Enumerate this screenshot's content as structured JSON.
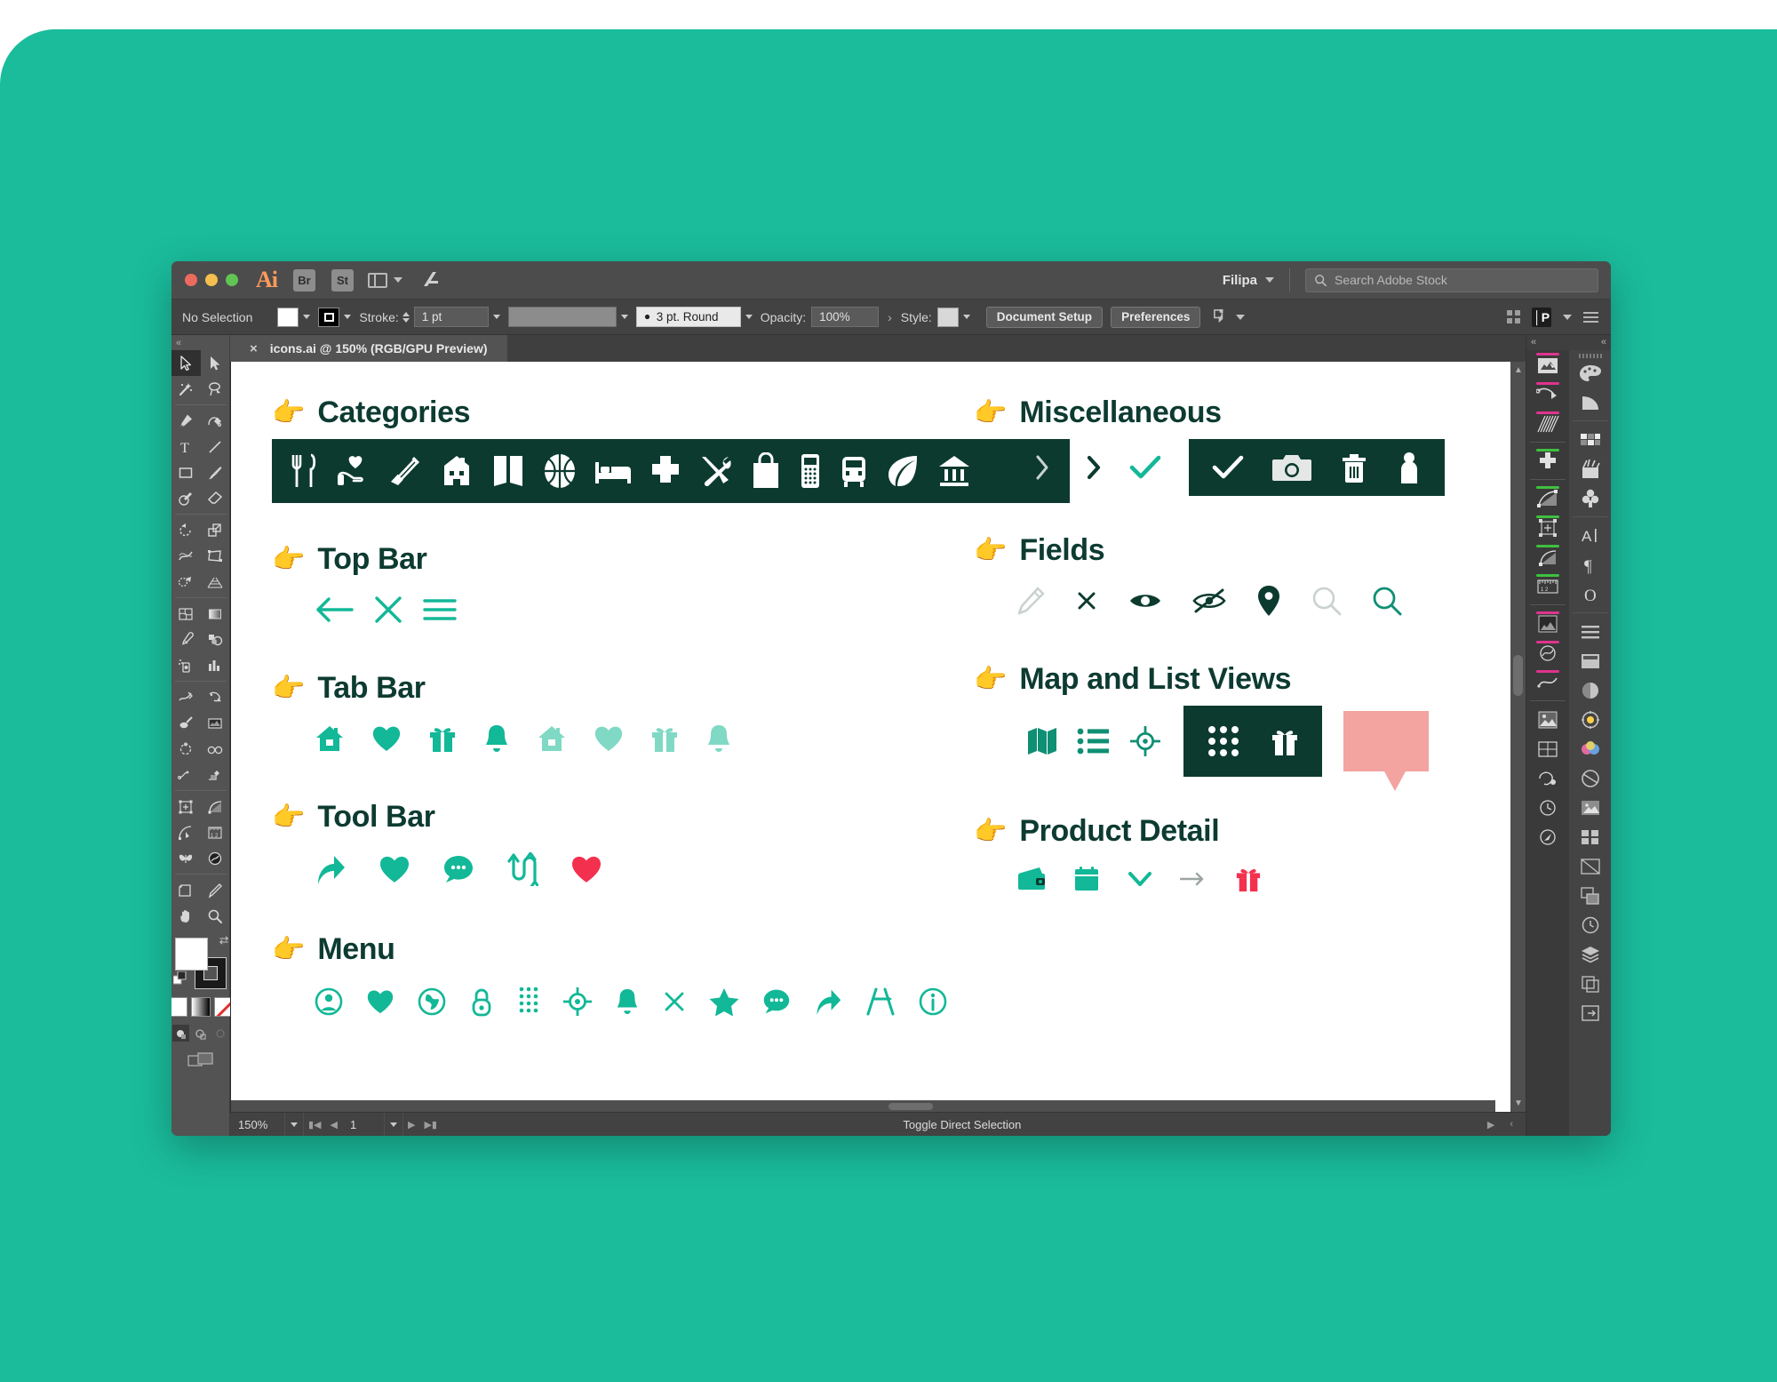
{
  "window": {
    "app_name": "Ai",
    "bridge_label": "Br",
    "stock_label": "St",
    "user_name": "Filipa",
    "stock_search_placeholder": "Search Adobe Stock",
    "traffic_lights": [
      "close",
      "minimize",
      "zoom"
    ]
  },
  "control_bar": {
    "selection_status": "No Selection",
    "stroke_label": "Stroke:",
    "stroke_weight": "1 pt",
    "brush_value": "3 pt. Round",
    "opacity_label": "Opacity:",
    "opacity_value": "100%",
    "style_label": "Style:",
    "document_setup": "Document Setup",
    "preferences": "Preferences"
  },
  "document_tab": {
    "close_glyph": "×",
    "title": "icons.ai @ 150% (RGB/GPU Preview)"
  },
  "status_bar": {
    "zoom": "150%",
    "page": "1",
    "status_text": "Toggle Direct Selection"
  },
  "artboard": {
    "pointer_emoji": "👉",
    "sections_left": [
      {
        "title": "Categories",
        "style": "dark-bar",
        "icons": [
          "cutlery-icon",
          "heart-hand-icon",
          "clothing-icon",
          "house-icon",
          "book-icon",
          "basketball-icon",
          "bed-icon",
          "medical-cross-icon",
          "tools-icon",
          "shopping-bag-icon",
          "mobile-phone-icon",
          "bus-icon",
          "leaf-icon",
          "bank-icon"
        ]
      },
      {
        "title": "Top Bar",
        "style": "plain",
        "icons": [
          "arrow-left-icon",
          "close-x-icon",
          "hamburger-menu-icon"
        ]
      },
      {
        "title": "Tab Bar",
        "style": "plain",
        "icons": [
          "home-icon",
          "heart-icon",
          "gift-icon",
          "bell-icon",
          "home-light-icon",
          "heart-light-icon",
          "gift-light-icon",
          "bell-light-icon"
        ]
      },
      {
        "title": "Tool Bar",
        "style": "plain",
        "icons": [
          "share-arrow-icon",
          "heart-icon",
          "chat-bubble-icon",
          "transfer-arrows-icon",
          "heart-red-icon"
        ]
      },
      {
        "title": "Menu",
        "style": "plain",
        "icons": [
          "user-circle-icon",
          "heart-icon",
          "globe-circle-icon",
          "lock-icon",
          "keypad-dots-icon",
          "crosshair-icon",
          "bell-icon",
          "close-x-icon",
          "star-icon",
          "chat-bubble-icon",
          "share-arrow-icon",
          "compass-route-icon",
          "info-circle-icon"
        ]
      }
    ],
    "sections_right": [
      {
        "title": "Miscellaneous",
        "style": "mixed-dark-bar",
        "icons": [
          "chevron-right-light-icon",
          "chevron-right-dark-icon",
          "check-teal-icon"
        ],
        "dark_icons": [
          "check-white-icon",
          "camera-icon",
          "trash-icon",
          "person-icon"
        ]
      },
      {
        "title": "Fields",
        "style": "plain",
        "icons": [
          "pencil-icon",
          "close-x-icon",
          "eye-icon",
          "eye-off-icon",
          "map-pin-icon",
          "search-grey-icon",
          "search-teal-icon"
        ]
      },
      {
        "title": "Map and List Views",
        "style": "mixed-dark-bar",
        "icons": [
          "map-icon",
          "list-icon",
          "crosshair-icon"
        ],
        "dark_icons": [
          "grid-dots-icon",
          "gift-white-icon"
        ],
        "trailing": "speech-bubble-pink-icon"
      },
      {
        "title": "Product Detail",
        "style": "plain",
        "icons": [
          "wallet-icon",
          "calendar-icon",
          "chevron-down-icon",
          "arrow-right-grey-icon",
          "gift-red-icon"
        ]
      }
    ]
  },
  "colors": {
    "page_background": "#1abc9c",
    "brand_teal": "#12b897",
    "dark_green": "#0c3a2f",
    "red_accent": "#f4304f",
    "pink_accent": "#f3a3a0",
    "light_teal": "#7fd9c4",
    "grey_icon": "#b8bfbd",
    "window_chrome": "#535353"
  },
  "left_toolbar": {
    "tools": [
      "selection-tool",
      "direct-selection-tool",
      "magic-wand-tool",
      "lasso-tool",
      "pen-tool",
      "curvature-tool",
      "type-tool",
      "line-segment-tool",
      "rectangle-tool",
      "paintbrush-tool",
      "shaper-tool",
      "eraser-tool",
      "rotate-tool",
      "scale-tool",
      "width-tool",
      "free-transform-tool",
      "shape-builder-tool",
      "perspective-grid-tool",
      "mesh-tool",
      "gradient-tool",
      "eyedropper-tool",
      "blend-tool",
      "symbol-sprayer-tool",
      "column-graph-tool",
      "slice-tool",
      "puppet-warp-tool",
      "hand-artboard-tool",
      "image-trace-tool",
      "live-paint-tool",
      "live-paint-selection-tool",
      "smooth-tool",
      "crop-tool",
      "transform-tool",
      "scale-corner-tool",
      "arc-tool",
      "measure-tool",
      "butterfly-tool",
      "recolor-tool",
      "artboard-tool",
      "knife-tool",
      "hand-tool",
      "zoom-tool"
    ],
    "fill_color": "#ffffff",
    "stroke_color": "#000000",
    "modes": [
      "color-mode",
      "gradient-mode",
      "none-mode"
    ],
    "draw_modes": [
      "draw-normal",
      "draw-behind",
      "draw-inside"
    ]
  },
  "right_dock": {
    "panels_left": [
      "libraries-panel",
      "brushes-panel",
      "symbols-panel",
      "add-panel",
      "gradient-panel",
      "transform-panel",
      "align-panel",
      "measure-panel",
      "pattern-panel",
      "appearance-panel",
      "stroke-panel",
      "effects-panel",
      "image-panel",
      "artboards-panel",
      "graphic-styles-panel",
      "layers-flat-panel",
      "history-panel",
      "navigator-panel"
    ],
    "panels_right": [
      "color-panel",
      "color-guide-panel",
      "swatches-panel",
      "brush-library-panel",
      "symbol-library-panel",
      "character-panel",
      "paragraph-panel",
      "glyphs-panel",
      "align-list-panel",
      "artboard-rect-panel",
      "transparency-panel",
      "appearance-circle-panel",
      "pathfinder-panel",
      "separations-panel",
      "asset-export-panel",
      "links-panel",
      "actions-panel",
      "layers-panel",
      "artboards-2-panel",
      "export-panel"
    ]
  }
}
